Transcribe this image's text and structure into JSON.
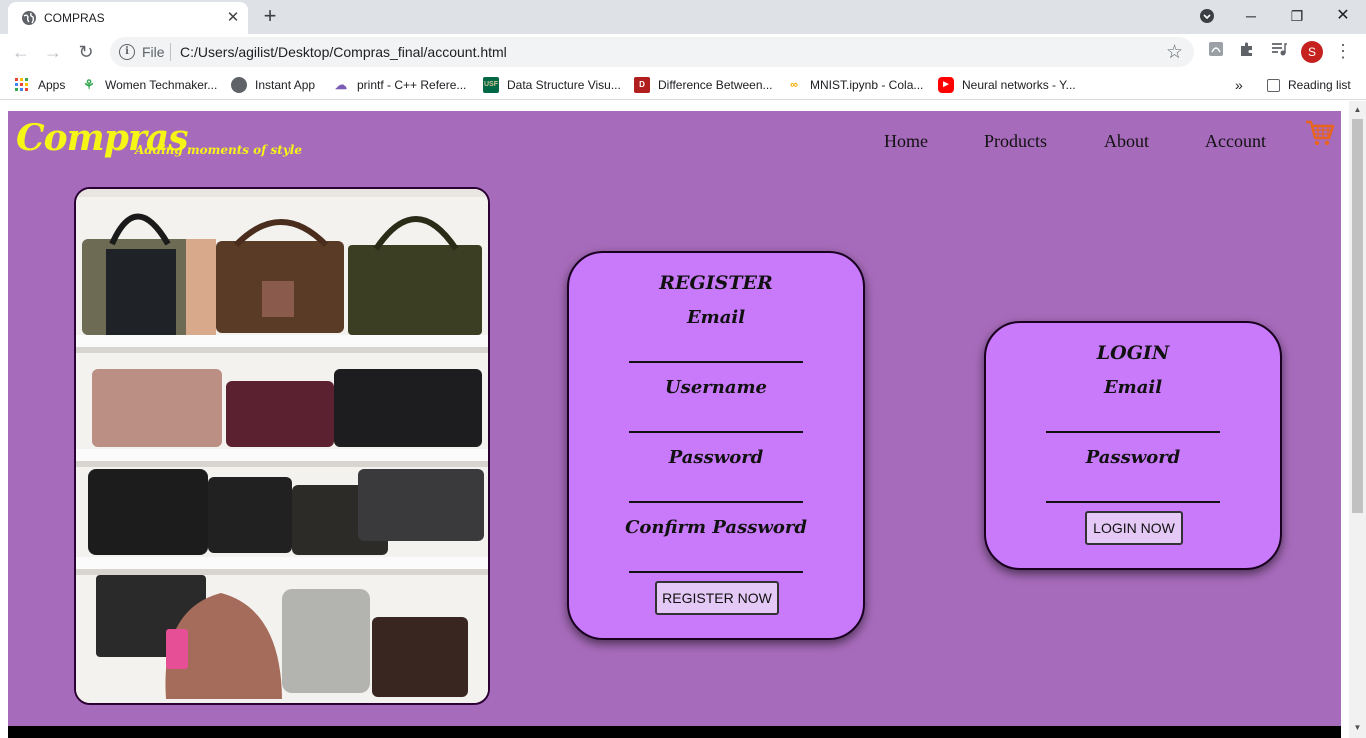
{
  "browser": {
    "tab_title": "COMPRAS",
    "url_scheme": "File",
    "url": "C:/Users/agilist/Desktop/Compras_final/account.html",
    "profile_initial": "S",
    "bookmarks": [
      {
        "label": "Apps",
        "icon": "apps-grid-icon"
      },
      {
        "label": "Women Techmaker...",
        "icon": "women-techmakers-icon"
      },
      {
        "label": "Instant App",
        "icon": "globe-icon"
      },
      {
        "label": "printf - C++ Refere...",
        "icon": "cpp-reference-icon"
      },
      {
        "label": "Data Structure Visu...",
        "icon": "usf-icon"
      },
      {
        "label": "Difference Between...",
        "icon": "td-icon"
      },
      {
        "label": "MNIST.ipynb - Cola...",
        "icon": "colab-icon"
      },
      {
        "label": "Neural networks - Y...",
        "icon": "youtube-icon"
      }
    ],
    "reading_list": "Reading list"
  },
  "site": {
    "logo": "Compras",
    "tagline": "Adding moments of style",
    "nav": [
      "Home",
      "Products",
      "About",
      "Account"
    ],
    "cart_icon": "shopping-cart-icon",
    "colors": {
      "background": "#a76bbb",
      "card": "#c87afa",
      "logo": "#f5f516"
    }
  },
  "register": {
    "title": "REGISTER",
    "email_label": "Email",
    "username_label": "Username",
    "password_label": "Password",
    "confirm_label": "Confirm Password",
    "button": "REGISTER NOW"
  },
  "login": {
    "title": "LOGIN",
    "email_label": "Email",
    "password_label": "Password",
    "button": "LOGIN NOW"
  }
}
